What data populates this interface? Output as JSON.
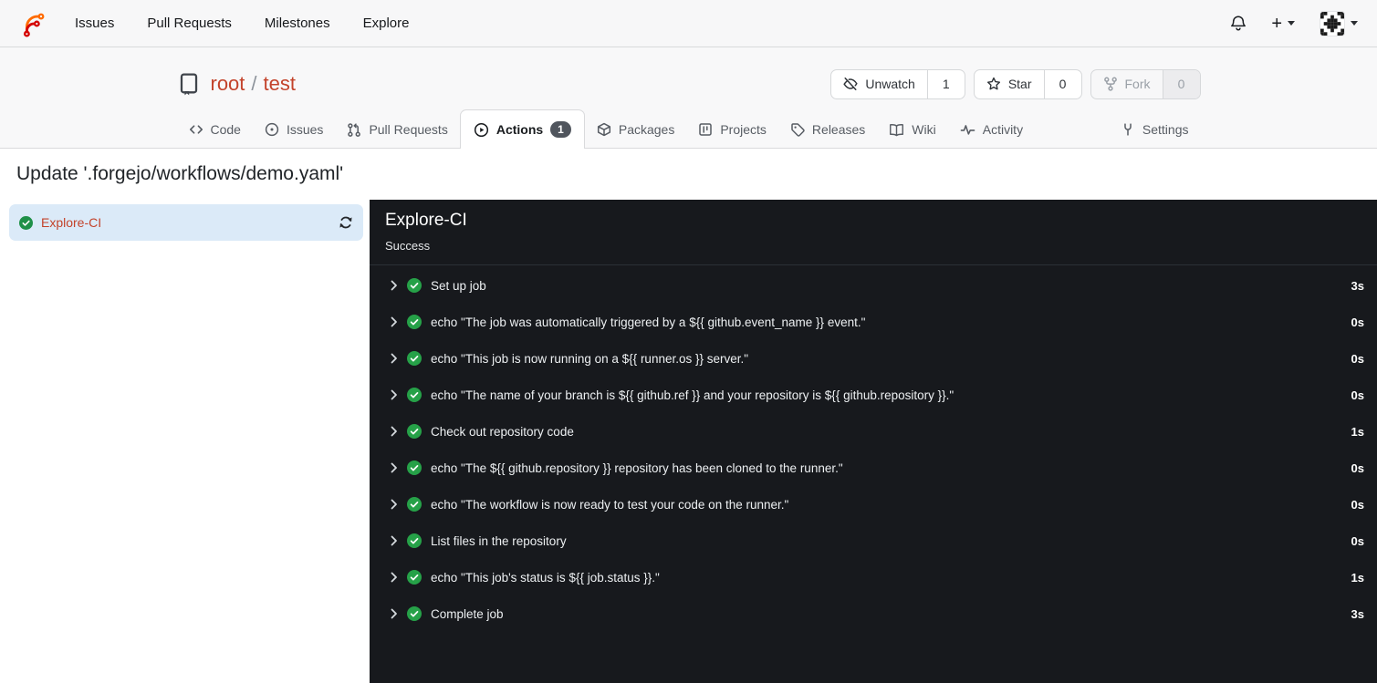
{
  "navbar": {
    "items": [
      {
        "label": "Issues"
      },
      {
        "label": "Pull Requests"
      },
      {
        "label": "Milestones"
      },
      {
        "label": "Explore"
      }
    ],
    "create_label": "+"
  },
  "repo_header": {
    "owner": "root",
    "separator": "/",
    "name": "test",
    "buttons": [
      {
        "label": "Unwatch",
        "count": "1",
        "icon": "eye-slash-icon"
      },
      {
        "label": "Star",
        "count": "0",
        "icon": "star-icon"
      },
      {
        "label": "Fork",
        "count": "0",
        "icon": "fork-icon",
        "disabled": true
      }
    ]
  },
  "tabs": [
    {
      "label": "Code",
      "icon": "code-icon"
    },
    {
      "label": "Issues",
      "icon": "issue-opened-icon"
    },
    {
      "label": "Pull Requests",
      "icon": "pull-request-icon"
    },
    {
      "label": "Actions",
      "icon": "play-circle-icon",
      "badge": "1",
      "active": true
    },
    {
      "label": "Packages",
      "icon": "package-icon"
    },
    {
      "label": "Projects",
      "icon": "project-board-icon"
    },
    {
      "label": "Releases",
      "icon": "tag-icon"
    },
    {
      "label": "Wiki",
      "icon": "book-icon"
    },
    {
      "label": "Activity",
      "icon": "pulse-icon"
    },
    {
      "label": "Settings",
      "icon": "tools-icon",
      "align": "right"
    }
  ],
  "page": {
    "title": "Update '.forgejo/workflows/demo.yaml'"
  },
  "jobs_sidebar": {
    "jobs": [
      {
        "name": "Explore-CI",
        "status": "success",
        "selected": true
      }
    ]
  },
  "run_panel": {
    "job_name": "Explore-CI",
    "status_text": "Success",
    "steps": [
      {
        "name": "Set up job",
        "duration": "3s"
      },
      {
        "name": "echo \"The job was automatically triggered by a ${{ github.event_name }} event.\"",
        "duration": "0s"
      },
      {
        "name": "echo \"This job is now running on a ${{ runner.os }} server.\"",
        "duration": "0s"
      },
      {
        "name": "echo \"The name of your branch is ${{ github.ref }} and your repository is ${{ github.repository }}.\"",
        "duration": "0s"
      },
      {
        "name": "Check out repository code",
        "duration": "1s"
      },
      {
        "name": "echo \"The ${{ github.repository }} repository has been cloned to the runner.\"",
        "duration": "0s"
      },
      {
        "name": "echo \"The workflow is now ready to test your code on the runner.\"",
        "duration": "0s"
      },
      {
        "name": "List files in the repository",
        "duration": "0s"
      },
      {
        "name": "echo \"This job's status is ${{ job.status }}.\"",
        "duration": "1s"
      },
      {
        "name": "Complete job",
        "duration": "3s"
      }
    ]
  },
  "colors": {
    "accent_link": "#c3432b",
    "success_green": "#26a148",
    "panel_bg": "#17191d",
    "selected_job_bg": "#dbeaf8",
    "badge_bg": "#50555d"
  }
}
